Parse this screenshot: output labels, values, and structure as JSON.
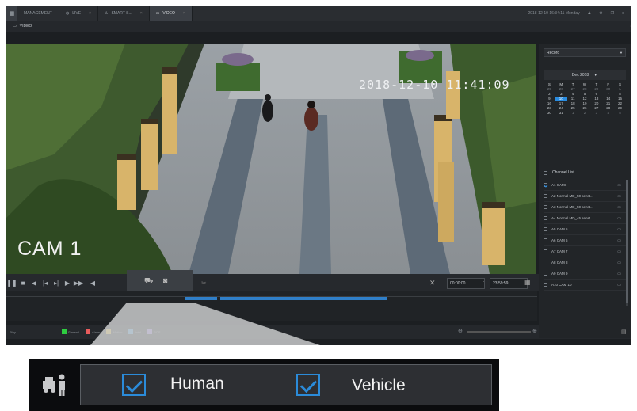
{
  "topbar": {
    "tabs": [
      {
        "label": "MANAGEMENT",
        "icon": "grid-icon"
      },
      {
        "label": "LIVE",
        "icon": "globe-icon"
      },
      {
        "label": "SMART S...",
        "icon": "person-search-icon"
      },
      {
        "label": "VIDEO",
        "icon": "video-icon"
      }
    ],
    "datetime": "2018-12-10 16:34:11 Monday"
  },
  "page": {
    "title": "VIDEO"
  },
  "video": {
    "timestamp": "2018-12-10 11:41:09",
    "camera_label": "CAM 1"
  },
  "playback": {
    "start_time": "00:00:00",
    "range_separator": "-",
    "end_time": "23:59:59"
  },
  "bottombar": {
    "type_label": "Play",
    "legend": [
      {
        "label": "General",
        "color": "#2ecc40"
      },
      {
        "label": "Alarm",
        "color": "#e85c5c"
      },
      {
        "label": "Motion",
        "color": "#e6c13a"
      },
      {
        "label": "Intel",
        "color": "#4aa3df"
      },
      {
        "label": "POS",
        "color": "#9b7fe0"
      }
    ]
  },
  "sidebar": {
    "record_select": "Record",
    "calendar": {
      "month": "Dec 2018",
      "weekdays": [
        "S",
        "M",
        "T",
        "W",
        "T",
        "F",
        "S"
      ],
      "days": [
        "25",
        "26",
        "27",
        "28",
        "29",
        "30",
        "1",
        "2",
        "3",
        "4",
        "5",
        "6",
        "7",
        "8",
        "9",
        "10",
        "11",
        "12",
        "13",
        "14",
        "15",
        "16",
        "17",
        "18",
        "19",
        "20",
        "21",
        "22",
        "23",
        "24",
        "25",
        "26",
        "27",
        "28",
        "29",
        "30",
        "31",
        "1",
        "2",
        "3",
        "4",
        "5"
      ],
      "selected": "10"
    },
    "channel_list_label": "Channel List",
    "channels": [
      {
        "label": "A1 CAM1",
        "checked": true
      },
      {
        "label": "A2 Normal MD_50 senst...",
        "checked": false
      },
      {
        "label": "A3 Normal MD_50 senst...",
        "checked": false
      },
      {
        "label": "A4 Normal MD_45 senst...",
        "checked": false
      },
      {
        "label": "A5 CAM 5",
        "checked": false
      },
      {
        "label": "A6 CAM 6",
        "checked": false
      },
      {
        "label": "A7 CAM 7",
        "checked": false
      },
      {
        "label": "A8 CAM 8",
        "checked": false
      },
      {
        "label": "A9 CAM 9",
        "checked": false
      },
      {
        "label": "A10 CAM 10",
        "checked": false
      }
    ]
  },
  "filter_callout": {
    "icon": "human-vehicle-filter-icon",
    "options": [
      {
        "label": "Human",
        "checked": true
      },
      {
        "label": "Vehicle",
        "checked": true
      }
    ],
    "check_color": "#2b8bd9"
  }
}
